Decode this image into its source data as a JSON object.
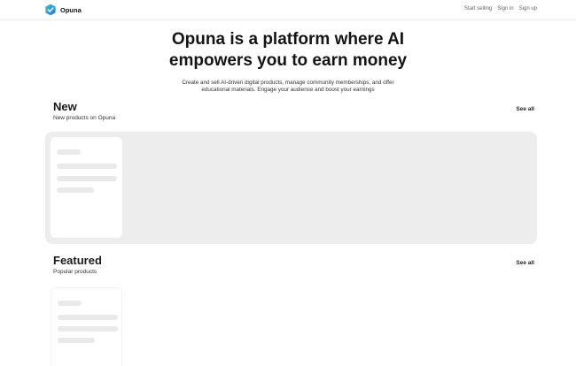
{
  "brand": {
    "name": "Opuna"
  },
  "nav": {
    "start_selling": "Start selling",
    "sign_in": "Sign in",
    "sign_up": "Sign up"
  },
  "hero": {
    "title_line1": "Opuna is a platform where AI",
    "title_line2": "empowers you to earn money",
    "subtitle": "Create and sell AI-driven digital products, manage community memberships, and offer educational materials. Engage your audience and boost your earnings"
  },
  "sections": {
    "new": {
      "title": "New",
      "subtitle": "New products on Opuna",
      "see_all": "See all"
    },
    "featured": {
      "title": "Featured",
      "subtitle": "Popular products",
      "see_all": "See all"
    }
  },
  "colors": {
    "accent_blue": "#2f7cf0",
    "accent_teal": "#32c4c0",
    "panel_bg": "#ededed",
    "skeleton": "#e9e9e9"
  }
}
